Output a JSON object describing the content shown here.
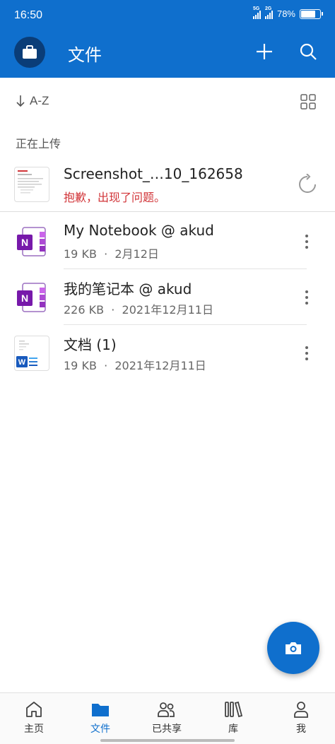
{
  "status_bar": {
    "time": "16:50",
    "network1": "5G",
    "network2": "2G",
    "battery": "78%"
  },
  "header": {
    "title": "文件"
  },
  "sort": {
    "label": "A-Z"
  },
  "uploading": {
    "section_title": "正在上传"
  },
  "upload_item": {
    "name": "Screenshot_…10_162658",
    "error": "抱歉，出现了问题。"
  },
  "files": [
    {
      "name": "My Notebook @ akud",
      "size": "19 KB",
      "date": "2月12日",
      "type": "onenote"
    },
    {
      "name": "我的笔记本 @ akud",
      "size": "226 KB",
      "date": "2021年12月11日",
      "type": "onenote"
    },
    {
      "name": "文档 (1)",
      "size": "19 KB",
      "date": "2021年12月11日",
      "type": "word"
    }
  ],
  "meta_separator": "·",
  "nav": {
    "home": "主页",
    "files": "文件",
    "shared": "已共享",
    "library": "库",
    "me": "我"
  },
  "colors": {
    "brand": "#0f6fcd",
    "onenote": "#7719aa",
    "word": "#185abd",
    "error": "#d13438"
  }
}
